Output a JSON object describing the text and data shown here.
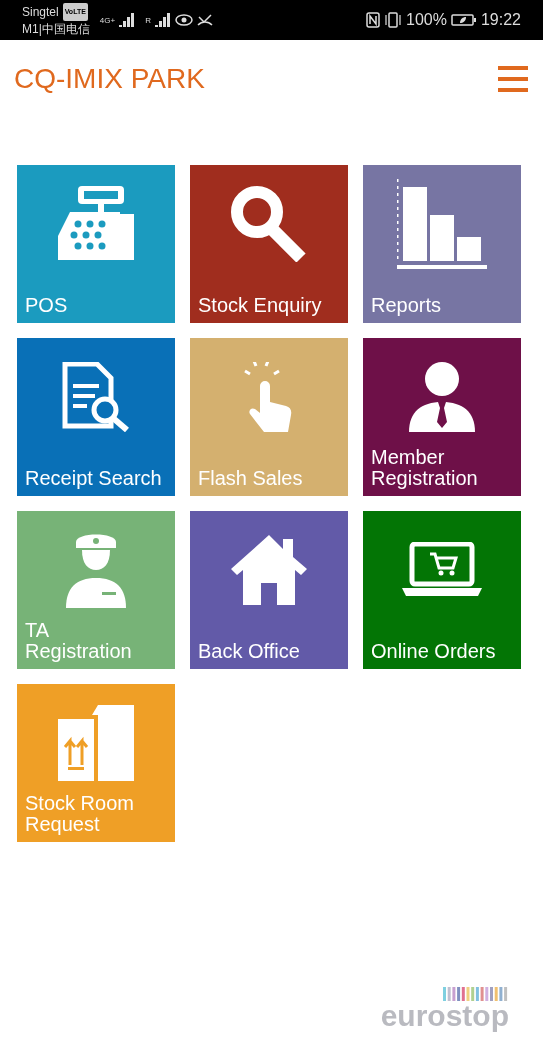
{
  "status_bar": {
    "carrier_1": "Singtel",
    "volte": "VoLTE",
    "network": "4G+",
    "carrier_2": "M1|中国电信",
    "roaming": "R",
    "battery": "100%",
    "time": "19:22"
  },
  "header": {
    "title": "CQ-IMIX PARK"
  },
  "tiles": [
    {
      "label": "POS",
      "color": "#1b9bbf"
    },
    {
      "label": "Stock Enquiry",
      "color": "#a02d1e"
    },
    {
      "label": "Reports",
      "color": "#7775a3"
    },
    {
      "label": "Receipt Search",
      "color": "#0970b7"
    },
    {
      "label": "Flash Sales",
      "color": "#d4b06f"
    },
    {
      "label": "Member\nRegistration",
      "color": "#6e1048"
    },
    {
      "label": "TA\nRegistration",
      "color": "#77b377"
    },
    {
      "label": "Back Office",
      "color": "#625aa8"
    },
    {
      "label": "Online Orders",
      "color": "#037505"
    },
    {
      "label": "Stock Room\nRequest",
      "color": "#ef9f26"
    }
  ],
  "footer": {
    "logo": "eurostop"
  }
}
